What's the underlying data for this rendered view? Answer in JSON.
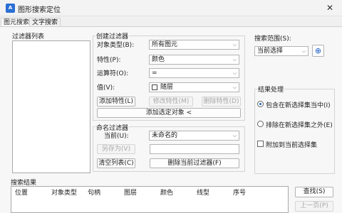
{
  "window": {
    "title": "图形搜索定位",
    "app_icon_text": "A",
    "close_glyph": "✕"
  },
  "tabs": [
    {
      "label": "图元搜索"
    },
    {
      "label": "文字搜索"
    }
  ],
  "filter_list": {
    "label": "过滤器列表"
  },
  "create_filter": {
    "label": "创建过滤器",
    "object_type_label": "对象类型(B):",
    "object_type_value": "所有图元",
    "property_label": "特性(P):",
    "property_value": "颜色",
    "operator_label": "运算符(O):",
    "operator_value": "=",
    "value_label": "值(V):",
    "value_value": "随层",
    "add_property": "添加特性(L)",
    "modify_property": "修改特性(M)",
    "delete_property": "删除特性(D)",
    "add_selected": "添加选定对象 <"
  },
  "named_filter": {
    "label": "命名过滤器",
    "current_label": "当前(U):",
    "current_value": "未命名的",
    "save_as": "另存为(V)",
    "clear_list": "清空列表(C)",
    "delete_current": "删除当前过滤器(F)"
  },
  "search_scope": {
    "label": "搜索范围(S):",
    "value": "当前选择"
  },
  "result_handling": {
    "label": "结果处理",
    "include": "包含在新选择集当中(I)",
    "exclude": "排除在新选择集之外(E)",
    "append": "附加到当前选择集"
  },
  "results": {
    "label": "搜索结果",
    "columns": [
      "位置",
      "对象类型",
      "句柄",
      "图层",
      "颜色",
      "线型",
      "序号"
    ],
    "search_btn": "查找(S)",
    "prev_btn": "上一页(P)"
  },
  "glyphs": {
    "dropdown": "⌵",
    "pick": "⊕"
  }
}
